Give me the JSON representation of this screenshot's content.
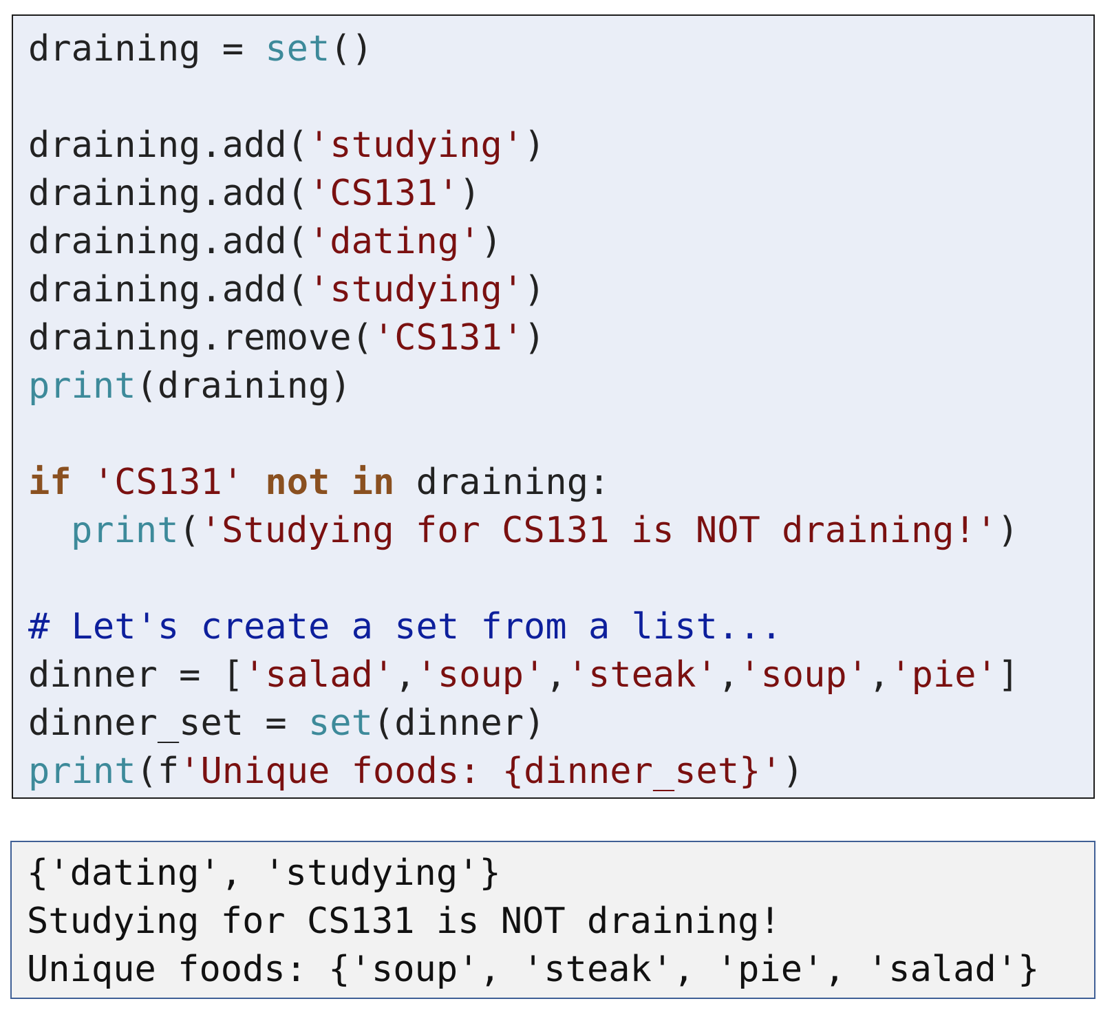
{
  "code": {
    "l1": {
      "a": "draining = ",
      "b": "set",
      "c": "()"
    },
    "l3": {
      "a": "draining.add(",
      "b": "'studying'",
      "c": ")"
    },
    "l4": {
      "a": "draining.add(",
      "b": "'CS131'",
      "c": ")"
    },
    "l5": {
      "a": "draining.add(",
      "b": "'dating'",
      "c": ")"
    },
    "l6": {
      "a": "draining.add(",
      "b": "'studying'",
      "c": ")"
    },
    "l7": {
      "a": "draining.remove(",
      "b": "'CS131'",
      "c": ")"
    },
    "l8": {
      "a": "print",
      "b": "(draining)"
    },
    "l10": {
      "a": "if",
      "b": " ",
      "c": "'CS131'",
      "d": " ",
      "e": "not",
      "f": " ",
      "g": "in",
      "h": " draining:"
    },
    "l11": {
      "a": "print",
      "b": "(",
      "c": "'Studying for CS131 is NOT draining!'",
      "d": ")"
    },
    "l13": {
      "a": "# Let's create a set from a list..."
    },
    "l14": {
      "a": "dinner = [",
      "b": "'salad'",
      "c": ",",
      "d": "'soup'",
      "e": ",",
      "f": "'steak'",
      "g": ",",
      "h": "'soup'",
      "i": ",",
      "j": "'pie'",
      "k": "]"
    },
    "l15": {
      "a": "dinner_set = ",
      "b": "set",
      "c": "(dinner)"
    },
    "l16": {
      "a": "print",
      "b": "(f",
      "c": "'Unique foods: {dinner_set}'",
      "d": ")"
    }
  },
  "output": {
    "line1": "{'dating', 'studying'}",
    "line2": "Studying for CS131 is NOT draining!",
    "line3": "Unique foods: {'soup', 'steak', 'pie', 'salad'}"
  }
}
